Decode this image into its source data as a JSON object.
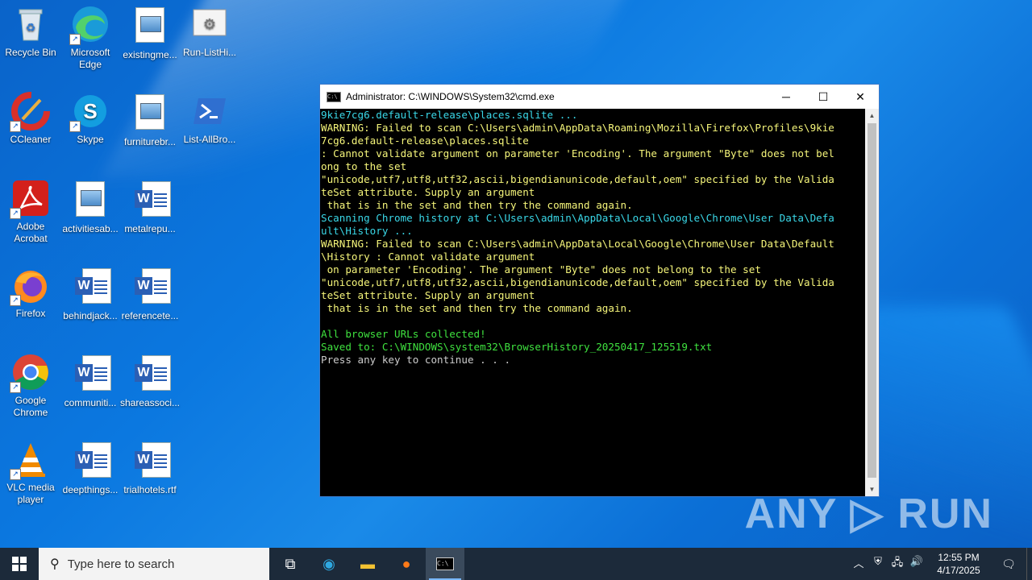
{
  "desktop_icons": [
    {
      "label": "Recycle Bin",
      "icon": "recycle-bin-icon"
    },
    {
      "label": "Microsoft Edge",
      "icon": "edge-icon"
    },
    {
      "label": "existingme...",
      "icon": "image-file-icon"
    },
    {
      "label": "Run-ListHi...",
      "icon": "script-icon"
    },
    {
      "label": "CCleaner",
      "icon": "ccleaner-icon"
    },
    {
      "label": "Skype",
      "icon": "skype-icon"
    },
    {
      "label": "furniturebr...",
      "icon": "image-file-icon"
    },
    {
      "label": "List-AllBro...",
      "icon": "powershell-icon"
    },
    {
      "label": "Adobe Acrobat",
      "icon": "acrobat-icon"
    },
    {
      "label": "activitiesab...",
      "icon": "image-file-icon"
    },
    {
      "label": "metalrepu...",
      "icon": "word-doc-icon"
    },
    {
      "label": "Firefox",
      "icon": "firefox-icon"
    },
    {
      "label": "behindjack...",
      "icon": "word-doc-icon"
    },
    {
      "label": "referencete...",
      "icon": "word-doc-icon"
    },
    {
      "label": "Google Chrome",
      "icon": "chrome-icon"
    },
    {
      "label": "communiti...",
      "icon": "word-doc-icon"
    },
    {
      "label": "shareassoci...",
      "icon": "word-doc-icon"
    },
    {
      "label": "VLC media player",
      "icon": "vlc-icon"
    },
    {
      "label": "deepthings...",
      "icon": "word-doc-icon"
    },
    {
      "label": "trialhotels.rtf",
      "icon": "word-doc-icon"
    }
  ],
  "window": {
    "title": "Administrator: C:\\WINDOWS\\System32\\cmd.exe",
    "minimize": "─",
    "maximize": "☐",
    "close": "✕"
  },
  "console_lines": [
    {
      "text": "9kie7cg6.default-release\\places.sqlite ...",
      "color": "#3ad8e8"
    },
    {
      "text": "WARNING: Failed to scan C:\\Users\\admin\\AppData\\Roaming\\Mozilla\\Firefox\\Profiles\\9kie",
      "color": "#f5f57a"
    },
    {
      "text": "7cg6.default-release\\places.sqlite",
      "color": "#f5f57a"
    },
    {
      "text": ": Cannot validate argument on parameter 'Encoding'. The argument \"Byte\" does not bel",
      "color": "#f5f57a"
    },
    {
      "text": "ong to the set",
      "color": "#f5f57a"
    },
    {
      "text": "\"unicode,utf7,utf8,utf32,ascii,bigendianunicode,default,oem\" specified by the Valida",
      "color": "#f5f57a"
    },
    {
      "text": "teSet attribute. Supply an argument",
      "color": "#f5f57a"
    },
    {
      "text": " that is in the set and then try the command again.",
      "color": "#f5f57a"
    },
    {
      "text": "Scanning Chrome history at C:\\Users\\admin\\AppData\\Local\\Google\\Chrome\\User Data\\Defa",
      "color": "#3ad8e8"
    },
    {
      "text": "ult\\History ...",
      "color": "#3ad8e8"
    },
    {
      "text": "WARNING: Failed to scan C:\\Users\\admin\\AppData\\Local\\Google\\Chrome\\User Data\\Default",
      "color": "#f5f57a"
    },
    {
      "text": "\\History : Cannot validate argument",
      "color": "#f5f57a"
    },
    {
      "text": " on parameter 'Encoding'. The argument \"Byte\" does not belong to the set",
      "color": "#f5f57a"
    },
    {
      "text": "\"unicode,utf7,utf8,utf32,ascii,bigendianunicode,default,oem\" specified by the Valida",
      "color": "#f5f57a"
    },
    {
      "text": "teSet attribute. Supply an argument",
      "color": "#f5f57a"
    },
    {
      "text": " that is in the set and then try the command again.",
      "color": "#f5f57a"
    },
    {
      "text": "",
      "color": "#cccccc"
    },
    {
      "text": "All browser URLs collected!",
      "color": "#3fe23f"
    },
    {
      "text": "Saved to: C:\\WINDOWS\\system32\\BrowserHistory_20250417_125519.txt",
      "color": "#3fe23f"
    },
    {
      "text": "Press any key to continue . . .",
      "color": "#cccccc"
    }
  ],
  "watermark": "ANY ▷ RUN",
  "taskbar": {
    "search_placeholder": "Type here to search",
    "apps": [
      {
        "name": "task-view-button",
        "icon": "task-view-icon",
        "glyph": "⧉",
        "active": false
      },
      {
        "name": "edge-taskbar-button",
        "icon": "edge-icon",
        "glyph": "◉",
        "active": false,
        "color": "#2fa8e0"
      },
      {
        "name": "explorer-taskbar-button",
        "icon": "folder-icon",
        "glyph": "▬",
        "active": false,
        "color": "#f2c232"
      },
      {
        "name": "firefox-taskbar-button",
        "icon": "firefox-icon",
        "glyph": "●",
        "active": false,
        "color": "#ff7a18"
      },
      {
        "name": "cmd-taskbar-button",
        "icon": "cmd-icon",
        "glyph": "▭",
        "active": true,
        "color": "#ffffff"
      }
    ],
    "tray_icons": [
      "chevron-up-icon",
      "security-icon",
      "network-icon",
      "volume-icon"
    ],
    "tray_glyphs": [
      "︿",
      "⛨",
      "🖧",
      "🔊"
    ],
    "time": "12:55 PM",
    "date": "4/17/2025",
    "notification_glyph": "🗨"
  }
}
